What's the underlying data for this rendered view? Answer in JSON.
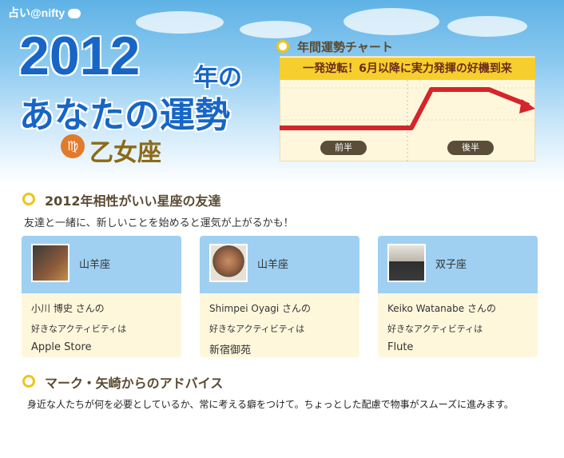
{
  "header": {
    "logo_text": "占い@nifty",
    "year": "2012",
    "year_suffix": "年の",
    "title_line2": "あなたの運勢",
    "sign_icon_glyph": "♍",
    "sign_name": "乙女座"
  },
  "chart": {
    "title": "年間運勢チャート",
    "banner": "一発逆転！6月以降に実力発揮の好機到来",
    "labels": [
      "前半",
      "後半"
    ],
    "colors": {
      "line": "#d6252a",
      "banner": "#f6cf2e"
    }
  },
  "compat": {
    "title": "2012年相性がいい星座の友達",
    "subtitle": "友達と一緒に、新しいことを始めると運気が上がるかも！",
    "cards": [
      {
        "sign": "山羊座",
        "name": "小川 博史 さんの",
        "like_label": "好きなアクティビティは",
        "activity": "Apple Store"
      },
      {
        "sign": "山羊座",
        "name": "Shimpei Oyagi さんの",
        "like_label": "好きなアクティビティは",
        "activity": "新宿御苑"
      },
      {
        "sign": "双子座",
        "name": "Keiko Watanabe さんの",
        "like_label": "好きなアクティビティは",
        "activity": "Flute"
      }
    ]
  },
  "advice": {
    "title": "マーク・矢崎からのアドバイス",
    "text": "身近な人たちが何を必要としているか、常に考える癖をつけて。ちょっとした配慮で物事がスムーズに進みます。"
  }
}
